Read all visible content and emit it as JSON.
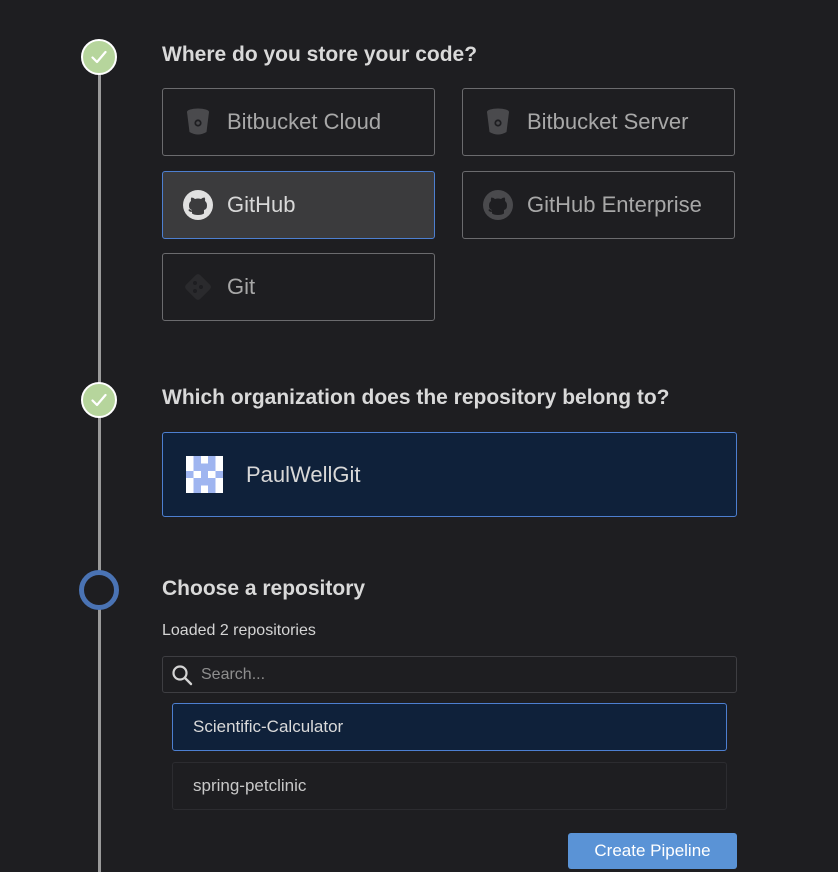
{
  "steps": [
    {
      "title": "Where do you store your code?",
      "status": "done"
    },
    {
      "title": "Which organization does the repository belong to?",
      "status": "done"
    },
    {
      "title": "Choose a repository",
      "status": "current"
    }
  ],
  "scm_options": [
    {
      "label": "Bitbucket Cloud",
      "icon": "bitbucket-icon",
      "selected": false
    },
    {
      "label": "Bitbucket Server",
      "icon": "bitbucket-icon",
      "selected": false
    },
    {
      "label": "GitHub",
      "icon": "github-icon",
      "selected": true
    },
    {
      "label": "GitHub Enterprise",
      "icon": "github-icon",
      "selected": false
    },
    {
      "label": "Git",
      "icon": "git-icon",
      "selected": false
    }
  ],
  "organization": {
    "name": "PaulWellGit",
    "selected": true
  },
  "repositories": {
    "count_text": "Loaded 2 repositories",
    "search_placeholder": "Search...",
    "items": [
      {
        "name": "Scientific-Calculator",
        "selected": true
      },
      {
        "name": "spring-petclinic",
        "selected": false
      }
    ]
  },
  "actions": {
    "create_label": "Create Pipeline"
  },
  "colors": {
    "background": "#1e1e21",
    "accent": "#4d7fd0",
    "done_step": "#b6d59c",
    "button": "#5a93d6",
    "selected_bg": "#0f213a"
  }
}
